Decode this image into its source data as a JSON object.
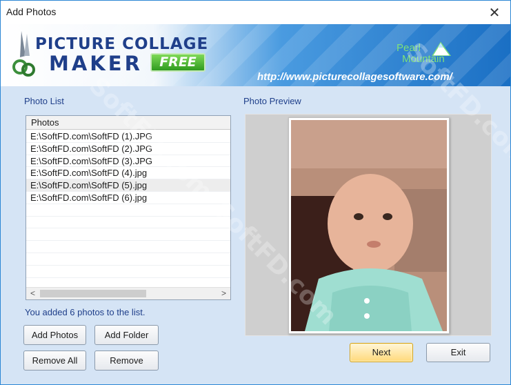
{
  "window": {
    "title": "Add Photos",
    "close_glyph": "✕"
  },
  "banner": {
    "logo_line1": "PICTURE COLLAGE",
    "logo_line2": "MAKER",
    "free_badge": "FREE",
    "brand_line1": "Pearl",
    "brand_line2": "Mountain",
    "url": "http://www.picturecollagesoftware.com/"
  },
  "photo_list": {
    "label": "Photo List",
    "column_header": "Photos",
    "items": [
      "E:\\SoftFD.com\\SoftFD (1).JPG",
      "E:\\SoftFD.com\\SoftFD (2).JPG",
      "E:\\SoftFD.com\\SoftFD (3).JPG",
      "E:\\SoftFD.com\\SoftFD (4).jpg",
      "E:\\SoftFD.com\\SoftFD (5).jpg",
      "E:\\SoftFD.com\\SoftFD (6).jpg"
    ],
    "scroll_left": "<",
    "scroll_right": ">"
  },
  "status_text": "You added 6 photos to the list.",
  "preview": {
    "label": "Photo Preview"
  },
  "buttons": {
    "add_photos": "Add Photos",
    "add_folder": "Add Folder",
    "remove_all": "Remove All",
    "remove": "Remove",
    "next": "Next",
    "exit": "Exit"
  },
  "watermark": "SoftFD.com",
  "colors": {
    "window_bg": "#d5e4f5",
    "label_blue": "#1f3f8a",
    "next_highlight": "#ffd97a",
    "free_green": "#2f9b1f"
  },
  "icons": {
    "close": "close-icon",
    "logo": "scissors-logo-icon",
    "brand": "mountain-peak-icon",
    "scroll_left": "chevron-left-icon",
    "scroll_right": "chevron-right-icon"
  }
}
